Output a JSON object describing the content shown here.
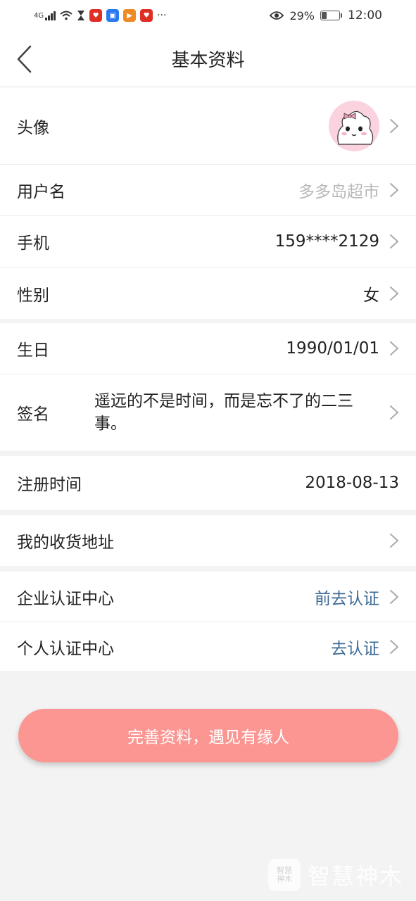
{
  "status_bar": {
    "network": "4G",
    "battery_percent": "29%",
    "time": "12:00",
    "more": "···"
  },
  "nav": {
    "title": "基本资料"
  },
  "groups": {
    "g1": {
      "avatar_label": "头像",
      "username_label": "用户名",
      "username_value": "多多岛超市",
      "phone_label": "手机",
      "phone_value": "159****2129",
      "gender_label": "性别",
      "gender_value": "女"
    },
    "g2": {
      "birthday_label": "生日",
      "birthday_value": "1990/01/01",
      "signature_label": "签名",
      "signature_value": "遥远的不是时间，而是忘不了的二三事。"
    },
    "g3": {
      "register_label": "注册时间",
      "register_value": "2018-08-13"
    },
    "g4": {
      "address_label": "我的收货地址"
    },
    "g5": {
      "enterprise_label": "企业认证中心",
      "enterprise_value": "前去认证",
      "personal_label": "个人认证中心",
      "personal_value": "去认证"
    }
  },
  "cta": {
    "label": "完善资料，遇见有缘人"
  },
  "watermark": {
    "badge": "智慧\n神木",
    "text": "智慧神木"
  },
  "colors": {
    "accent_button": "#fb9692",
    "link_blue": "#3d6a95",
    "placeholder_gray": "#b8b8b8"
  }
}
